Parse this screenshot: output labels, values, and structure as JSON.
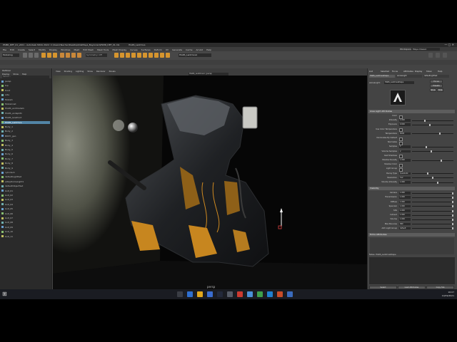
{
  "window": {
    "title": "PSMR_DEF_01_v001 - Autodesk MAYA 2022: C:\\Users\\Teacher\\Desktop\\DelMaya_Bayonzen\\PSMR_DEF_01.mb",
    "active_object": "HGRS_LenDrive"
  },
  "menubar": {
    "items": [
      "File",
      "Edit",
      "Create",
      "Select",
      "Modify",
      "Display",
      "Windows",
      "Mesh",
      "Edit Mesh",
      "Mesh Tools",
      "Mesh Display",
      "Curves",
      "Surfaces",
      "Deform",
      "UV",
      "Generate",
      "Cache",
      "Arnold",
      "Help"
    ],
    "workspace_label": "Workspace:",
    "workspace_value": "Maya Classic"
  },
  "shelf": {
    "mode": "Modeling",
    "search_placeholder": "Symmetry: Off",
    "object_field": "HGRS_LenDrive1"
  },
  "outliner": {
    "title": "Outliner",
    "menus": [
      "Display",
      "Show",
      "Help"
    ],
    "search_placeholder": "Search...",
    "rows": [
      {
        "label": "persp",
        "sel": false
      },
      {
        "label": "top",
        "sel": false
      },
      {
        "label": "front",
        "sel": false
      },
      {
        "label": "side",
        "sel": false
      },
      {
        "label": "Model1",
        "sel": false
      },
      {
        "label": "Modelcoat",
        "sel": false
      },
      {
        "label": "HGRS_endmodel1",
        "sel": false
      },
      {
        "label": "HGRS_endsplit1",
        "sel": false
      },
      {
        "label": "HGRS_lensfront",
        "sel": false
      },
      {
        "label": "HGRS_LenDrive",
        "sel": true
      },
      {
        "label": "Body_1",
        "sel": false
      },
      {
        "label": "Body_2",
        "sel": false
      },
      {
        "label": "BODY_geo",
        "sel": false
      },
      {
        "label": "Body_3",
        "sel": false
      },
      {
        "label": "Body_4",
        "sel": false
      },
      {
        "label": "Body_5",
        "sel": false
      },
      {
        "label": "Body_6",
        "sel": false
      },
      {
        "label": "Body_7",
        "sel": false
      },
      {
        "label": "Body_8",
        "sel": false
      },
      {
        "label": "Body_9",
        "sel": false
      },
      {
        "label": "cylinder1",
        "sel": false
      },
      {
        "label": "defaultLightSet",
        "sel": false
      },
      {
        "label": "aiSkyDomeLight1",
        "sel": false
      },
      {
        "label": "defaultObjectSet",
        "sel": false
      },
      {
        "label": "bolt_01",
        "sel": false
      },
      {
        "label": "bolt_02",
        "sel": false
      },
      {
        "label": "bolt_03",
        "sel": false
      },
      {
        "label": "bolt_04",
        "sel": false
      },
      {
        "label": "bolt_05",
        "sel": false
      },
      {
        "label": "bolt_06",
        "sel": false
      },
      {
        "label": "bolt_07",
        "sel": false
      },
      {
        "label": "bolt_08",
        "sel": false
      },
      {
        "label": "bolt_09",
        "sel": false
      },
      {
        "label": "bolt_10",
        "sel": false
      },
      {
        "label": "bolt_11",
        "sel": false
      }
    ]
  },
  "viewport": {
    "menus": [
      "View",
      "Shading",
      "Lighting",
      "Show",
      "Renderer",
      "Panels"
    ],
    "camera_field": "HGRS_LenDrive1 | persp",
    "camera_label": "persp"
  },
  "attribute_editor": {
    "tabs": [
      "List",
      "Selected",
      "Focus",
      "Attributes",
      "Display",
      "Show",
      "Help"
    ],
    "node_tabs": [
      "HGRS_LenDriveShape",
      "aiAreaLight",
      "defaultLightSet"
    ],
    "shape_label": "aiAreaLight:",
    "shape_value": "HGRS_LenDriveShape",
    "focus_btn": "Focus",
    "presets_btn": "Presets",
    "show_btn": "Show",
    "hide_btn": "Hide",
    "section_main": "Area Light Attributes",
    "rows_main": [
      {
        "label": "Color",
        "value": ""
      },
      {
        "label": "Intensity",
        "value": "1.000"
      },
      {
        "label": "Exposure",
        "value": "0.000"
      },
      {
        "label": "Use Color Temperature",
        "value": ""
      },
      {
        "label": "Temperature",
        "value": "6500"
      },
      {
        "label": "Illuminates By Default",
        "value": ""
      },
      {
        "label": "Normalize",
        "value": ""
      },
      {
        "label": "Samples",
        "value": "1"
      },
      {
        "label": "Volume Samples",
        "value": "2"
      },
      {
        "label": "Cast Shadows",
        "value": ""
      },
      {
        "label": "Shadow Density",
        "value": "1.000"
      },
      {
        "label": "Shadow Color",
        "value": ""
      },
      {
        "label": "Light Group",
        "value": ""
      },
      {
        "label": "Decay Type",
        "value": "Quadratic"
      },
      {
        "label": "Resolution",
        "value": "512"
      },
      {
        "label": "Volume Intensity",
        "value": "1.000"
      }
    ],
    "section_visibility": "Visibility",
    "rows_visibility": [
      {
        "label": "Camera",
        "value": "1.000"
      },
      {
        "label": "Transmission",
        "value": "1.000"
      },
      {
        "label": "Diffuse",
        "value": "1.000"
      },
      {
        "label": "Specular",
        "value": "1.000"
      },
      {
        "label": "SSS",
        "value": "1.000"
      },
      {
        "label": "Indirect",
        "value": "1.000"
      },
      {
        "label": "Volume",
        "value": "1.000"
      },
      {
        "label": "Max Bounces",
        "value": "999"
      },
      {
        "label": "AOV Light Group",
        "value": "default"
      }
    ],
    "section_extra": "Extra Attributes",
    "notes_label": "Notes: HGRS_LenDriveShape",
    "select_btn": "Select",
    "load_btn": "Load Attributes",
    "copy_btn": "Copy Tab"
  },
  "taskbar": {
    "time": "16:07",
    "date": "10/09/2021"
  }
}
